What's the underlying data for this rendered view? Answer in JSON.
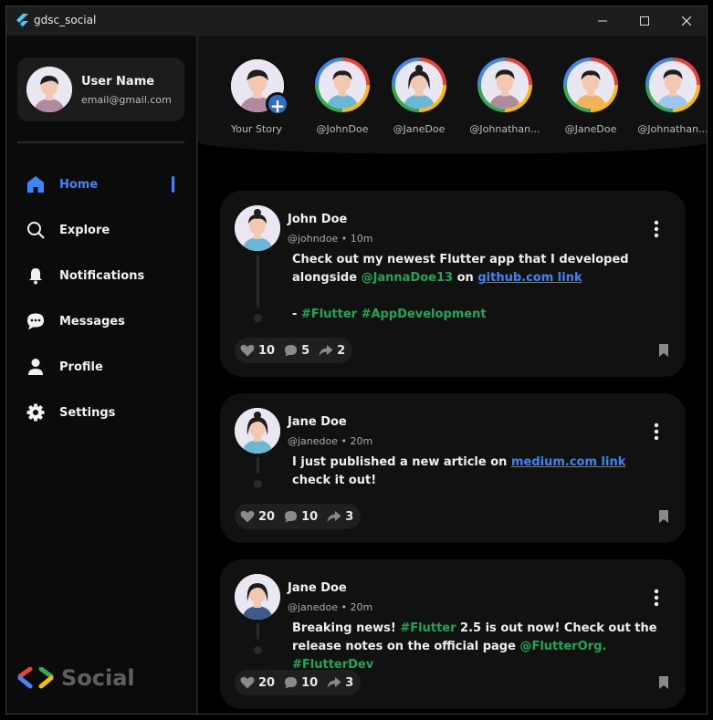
{
  "window": {
    "title": "gdsc_social"
  },
  "sidebar": {
    "user": {
      "name": "User Name",
      "email": "email@gmail.com"
    },
    "nav": [
      {
        "label": "Home",
        "icon": "home-icon",
        "active": true
      },
      {
        "label": "Explore",
        "icon": "search-icon",
        "active": false
      },
      {
        "label": "Notifications",
        "icon": "bell-icon",
        "active": false
      },
      {
        "label": "Messages",
        "icon": "chat-bubble-icon",
        "active": false
      },
      {
        "label": "Profile",
        "icon": "person-icon",
        "active": false
      },
      {
        "label": "Settings",
        "icon": "gear-icon",
        "active": false
      }
    ],
    "brand": "Social"
  },
  "stories": [
    {
      "label": "Your Story"
    },
    {
      "label": "@JohnDoe"
    },
    {
      "label": "@JaneDoe"
    },
    {
      "label": "@Johnathan..."
    },
    {
      "label": "@JaneDoe"
    },
    {
      "label": "@Johnathan..."
    }
  ],
  "posts": [
    {
      "name": "John Doe",
      "meta": "@johndoe • 10m",
      "text": {
        "t1": "Check out my newest Flutter app that I developed alongside ",
        "m1": "@JannaDoe13",
        "t2": " on ",
        "l1": "github.com link",
        "t3": "- ",
        "h1": "#Flutter #AppDevelopment"
      },
      "likes": "10",
      "comments": "5",
      "shares": "2"
    },
    {
      "name": "Jane Doe",
      "meta": "@janedoe • 20m",
      "text": {
        "t1": "I just published a new article on ",
        "l1": "medium.com link",
        "t2": " check it out!"
      },
      "likes": "20",
      "comments": "10",
      "shares": "3"
    },
    {
      "name": "Jane Doe",
      "meta": "@janedoe • 20m",
      "text": {
        "t1": "Breaking news! ",
        "h1": "#Flutter",
        "t2": " 2.5 is out now! Check out the release notes on the official page ",
        "h2": "@FlutterOrg. #FlutterDev"
      },
      "likes": "20",
      "comments": "10",
      "shares": "3"
    }
  ],
  "colors": {
    "accent": "#3d85f7",
    "tag": "#1ea658",
    "panel": "#111111"
  }
}
